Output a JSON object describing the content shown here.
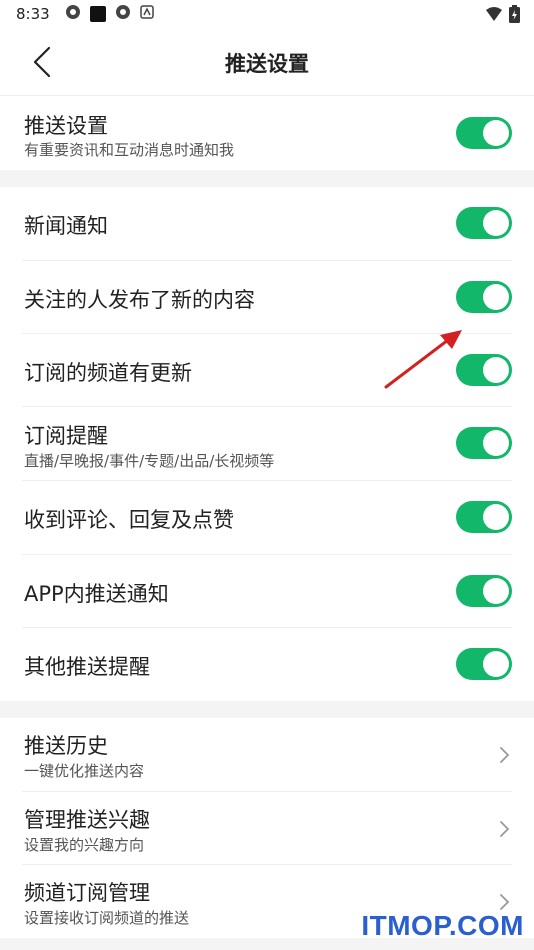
{
  "status_bar": {
    "time": "8:33"
  },
  "nav": {
    "title": "推送设置"
  },
  "push_master": {
    "title": "推送设置",
    "subtitle": "有重要资讯和互动消息时通知我",
    "enabled": true
  },
  "notifications": [
    {
      "title": "新闻通知",
      "subtitle": "",
      "enabled": true
    },
    {
      "title": "关注的人发布了新的内容",
      "subtitle": "",
      "enabled": true
    },
    {
      "title": "订阅的频道有更新",
      "subtitle": "",
      "enabled": true
    },
    {
      "title": "订阅提醒",
      "subtitle": "直播/早晚报/事件/专题/出品/长视频等",
      "enabled": true
    },
    {
      "title": "收到评论、回复及点赞",
      "subtitle": "",
      "enabled": true
    },
    {
      "title": "APP内推送通知",
      "subtitle": "",
      "enabled": true
    },
    {
      "title": "其他推送提醒",
      "subtitle": "",
      "enabled": true
    }
  ],
  "links": [
    {
      "title": "推送历史",
      "subtitle": "一键优化推送内容"
    },
    {
      "title": "管理推送兴趣",
      "subtitle": "设置我的兴趣方向"
    },
    {
      "title": "频道订阅管理",
      "subtitle": "设置接收订阅频道的推送"
    }
  ],
  "watermark": "ITMOP.COM",
  "colors": {
    "toggle_on": "#12b76a",
    "background_gap": "#f4f4f4",
    "arrow": "#d32020"
  }
}
